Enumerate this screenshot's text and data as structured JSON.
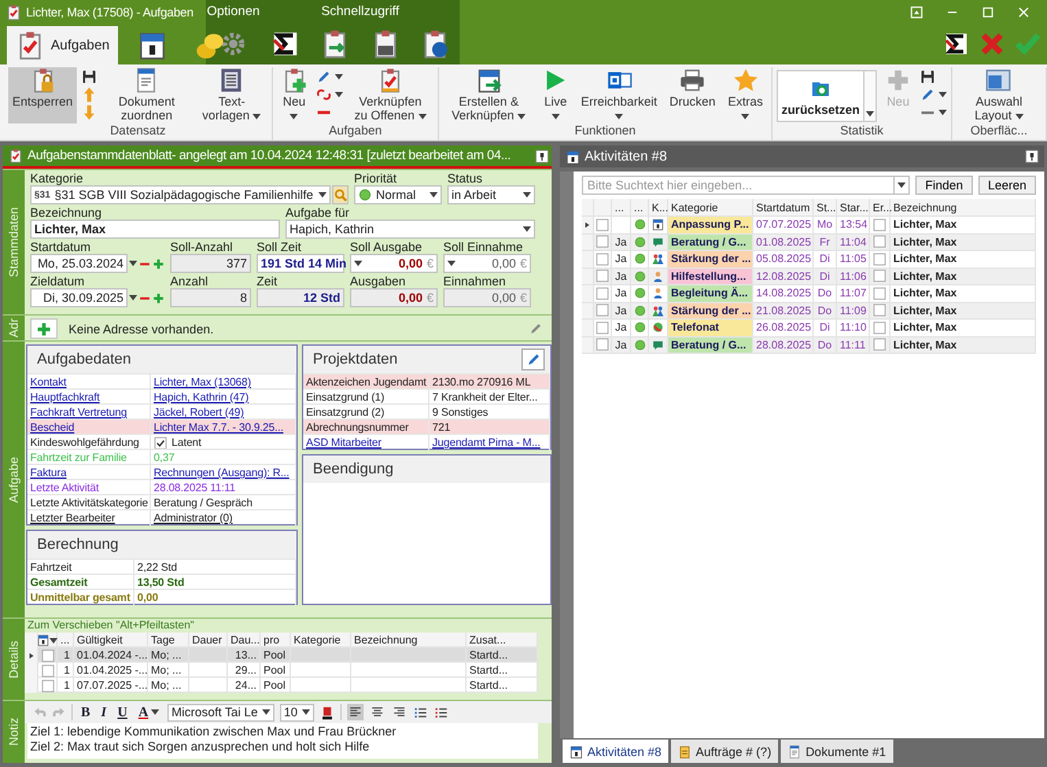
{
  "window": {
    "title": "Lichter, Max (17508) - Aufgaben"
  },
  "context_tabs": [
    {
      "label": "Optionen"
    },
    {
      "label": "Schnellzugriff"
    }
  ],
  "ribbon_tabs": [
    {
      "label": "Aufgaben",
      "selected": true
    },
    {
      "selected": false
    },
    {
      "selected": false
    }
  ],
  "ribbon_groups": [
    {
      "label": "Datensatz",
      "items": [
        {
          "kind": "large",
          "label": "Entsperren",
          "selected": true,
          "dropdown": false,
          "disabled": false
        },
        {
          "kind": "stack",
          "items": [
            {
              "dropdown": false
            },
            {
              "dropdown": false
            },
            {
              "dropdown": false
            }
          ]
        },
        {
          "kind": "large",
          "label": "Dokument zuordnen",
          "selected": false,
          "dropdown": false,
          "disabled": false
        },
        {
          "kind": "large",
          "label": "Text-vorlagen",
          "selected": false,
          "dropdown": true,
          "disabled": false
        }
      ]
    },
    {
      "label": "Aufgaben",
      "items": [
        {
          "kind": "large",
          "label": "Neu",
          "selected": false,
          "dropdown": true,
          "disabled": false
        },
        {
          "kind": "stack",
          "items": [
            {
              "dropdown": true
            },
            {
              "dropdown": true
            },
            {
              "dropdown": false
            }
          ]
        },
        {
          "kind": "large",
          "label": "Verknüpfen zu Offenen",
          "selected": false,
          "dropdown": true,
          "disabled": false
        }
      ]
    },
    {
      "label": "Funktionen",
      "items": [
        {
          "kind": "large",
          "label": "Erstellen & Verknüpfen",
          "selected": false,
          "dropdown": true,
          "disabled": false
        },
        {
          "kind": "large",
          "label": "Live",
          "selected": false,
          "dropdown": true,
          "disabled": false
        },
        {
          "kind": "large",
          "label": "Erreichbarkeit",
          "selected": false,
          "dropdown": true,
          "disabled": false
        },
        {
          "kind": "large",
          "label": "Drucken",
          "selected": false,
          "dropdown": false,
          "disabled": false
        },
        {
          "kind": "large",
          "label": "Extras",
          "selected": false,
          "dropdown": true,
          "disabled": false
        }
      ]
    },
    {
      "label": "Statistik",
      "items": [
        {
          "kind": "gallery",
          "label": "zurücksetzen"
        },
        {
          "kind": "large",
          "label": "Neu",
          "selected": false,
          "dropdown": false,
          "disabled": true
        },
        {
          "kind": "stack",
          "items": [
            {
              "dropdown": false
            },
            {
              "dropdown": true
            },
            {
              "dropdown": true
            }
          ]
        }
      ]
    },
    {
      "label": "Oberfläc...",
      "items": [
        {
          "kind": "large",
          "label": "Auswahl Layout",
          "selected": false,
          "dropdown": true,
          "disabled": false
        }
      ]
    }
  ],
  "task_sheet": {
    "title": "Aufgabenstammdatenblatt- angelegt am 10.04.2024 12:48:31 [zuletzt bearbeitet am 04...",
    "side_tabs": [
      "Stammdaten",
      "Adr",
      "Aufgabe",
      "Details",
      "Notiz"
    ]
  },
  "master_data": {
    "category": {
      "label": "Kategorie",
      "badge": "§31",
      "value": "§31 SGB VIII Sozialpädagogische Familienhilfe"
    },
    "priority": {
      "label": "Priorität",
      "value": "Normal"
    },
    "status": {
      "label": "Status",
      "value": "in Arbeit"
    },
    "title": {
      "label": "Bezeichnung",
      "value": "Lichter, Max"
    },
    "assignee": {
      "label": "Aufgabe für",
      "value": "Hapich, Kathrin"
    },
    "start_date": {
      "label": "Startdatum",
      "value": "Mo, 25.03.2024"
    },
    "target_count": {
      "label": "Soll-Anzahl",
      "value": "377",
      "readonly": true
    },
    "target_time": {
      "label": "Soll Zeit",
      "value": "191 Std 14 Min",
      "readonly": false
    },
    "target_expense": {
      "label": "Soll Ausgabe",
      "value": "0,00",
      "currency": "€",
      "kind": "expense",
      "dropdown": true,
      "readonly": false
    },
    "target_income": {
      "label": "Soll Einnahme",
      "value": "0,00",
      "currency": "€",
      "kind": "income",
      "dropdown": true,
      "readonly": false
    },
    "end_date": {
      "label": "Zieldatum",
      "value": "Di, 30.09.2025"
    },
    "count": {
      "label": "Anzahl",
      "value": "8",
      "readonly": true
    },
    "time": {
      "label": "Zeit",
      "value": "12 Std",
      "readonly": true
    },
    "expenses": {
      "label": "Ausgaben",
      "value": "0,00",
      "currency": "€",
      "kind": "expense",
      "dropdown": false,
      "readonly": true
    },
    "income": {
      "label": "Einnahmen",
      "value": "0,00",
      "currency": "€",
      "kind": "income",
      "dropdown": false,
      "readonly": true
    }
  },
  "address": {
    "text": "Keine Adresse vorhanden."
  },
  "task_data": {
    "title": "Aufgabedaten",
    "rows": [
      {
        "label": "Kontakt",
        "value": "Lichter, Max (13068)",
        "kind": "link",
        "highlighted": false
      },
      {
        "label": "Hauptfachkraft",
        "value": "Hapich, Kathrin (47)",
        "kind": "link",
        "highlighted": false
      },
      {
        "label": "Fachkraft Vertretung",
        "value": "Jäckel, Robert (49)",
        "kind": "link",
        "highlighted": false
      },
      {
        "label": "Bescheid",
        "value": "Lichter Max 7.7. - 30.9.25...",
        "kind": "link",
        "highlighted": true
      },
      {
        "label": "Kindeswohlgefährdung",
        "value": "Latent",
        "kind": "check",
        "checked": true,
        "highlighted": false
      },
      {
        "label": "Fahrtzeit zur Familie",
        "value": "0,37",
        "kind": "travel",
        "highlighted": false
      },
      {
        "label": "Faktura",
        "value": "Rechnungen (Ausgang): R...",
        "kind": "link",
        "highlighted": false
      },
      {
        "label": "Letzte Aktivität",
        "value": "28.08.2025 11:11",
        "kind": "recent",
        "highlighted": false
      },
      {
        "label": "Letzte Aktivitätskategorie",
        "value": "Beratung / Gespräch",
        "kind": "plain",
        "highlighted": false
      },
      {
        "label": "Letzter Bearbeiter",
        "value": "Administrator (0)",
        "kind": "user",
        "highlighted": false
      }
    ]
  },
  "calculation": {
    "title": "Berechnung",
    "rows": [
      {
        "label": "Fahrtzeit",
        "value": "2,22 Std",
        "kind": "plain"
      },
      {
        "label": "Gesamtzeit",
        "value": "13,50 Std",
        "kind": "total"
      },
      {
        "label": "Unmittelbar gesamt",
        "value": "0,00",
        "kind": "direct"
      }
    ]
  },
  "project_data": {
    "title": "Projektdaten",
    "rows": [
      {
        "label": "Aktenzeichen Jugendamt",
        "value": "2130.mo 270916 ML",
        "kind": "plain",
        "highlighted": true
      },
      {
        "label": "Einsatzgrund (1)",
        "value": "7 Krankheit der Elter...",
        "kind": "plain",
        "highlighted": false
      },
      {
        "label": "Einsatzgrund (2)",
        "value": "9 Sonstiges",
        "kind": "plain",
        "highlighted": false
      },
      {
        "label": "Abrechnungsnummer",
        "value": "721",
        "kind": "plain",
        "highlighted": true
      },
      {
        "label": "ASD Mitarbeiter",
        "value": "Jugendamt Pirna - M...",
        "kind": "link",
        "highlighted": false
      }
    ]
  },
  "termination": {
    "title": "Beendigung"
  },
  "details": {
    "hint": "Zum Verschieben \"Alt+Pfeiltasten\"",
    "columns": [
      "...",
      "Gültigkeit",
      "Tage",
      "Dauer",
      "Dau...",
      "pro",
      "Kategorie",
      "Bezeichnung",
      "Zusat..."
    ],
    "rows": [
      {
        "selected": true,
        "checked": false,
        "cells": [
          "1",
          "01.04.2024 -...",
          "Mo; ...",
          null,
          "13...",
          "Pool",
          null,
          null,
          "Startd..."
        ]
      },
      {
        "selected": false,
        "checked": false,
        "cells": [
          "1",
          "01.04.2025 -...",
          "Mo; ...",
          null,
          "29...",
          "Pool",
          null,
          null,
          "Startd..."
        ]
      },
      {
        "selected": false,
        "checked": false,
        "cells": [
          "1",
          "07.07.2025 -...",
          "Mo; ...",
          null,
          "24...",
          "Pool",
          null,
          null,
          "Startd..."
        ]
      }
    ]
  },
  "note": {
    "history": [
      {
        "disabled": true
      },
      {
        "disabled": true
      }
    ],
    "format_buttons": [
      {
        "label": "B"
      },
      {
        "label": "I"
      },
      {
        "label": "U"
      },
      {
        "label": "A",
        "dropdown": true
      }
    ],
    "font": "Microsoft Tai Le",
    "size": "10",
    "alignment": [
      {
        "selected": true
      },
      {
        "selected": false
      },
      {
        "selected": false
      }
    ],
    "lines": [
      "Ziel 1: lebendige Kommunikation zwischen Max und Frau Brückner",
      "Ziel 2: Max traut sich Sorgen anzusprechen und holt sich Hilfe"
    ]
  },
  "activities": {
    "title": "Aktivitäten #8",
    "search": {
      "placeholder": "Bitte Suchtext hier eingeben..."
    },
    "buttons": [
      "Finden",
      "Leeren"
    ],
    "columns": [
      "...",
      "...",
      "K...",
      "Kategorie",
      "Startdatum",
      "St...",
      "Star...",
      "Er...",
      "Bezeichnung"
    ],
    "rows": [
      {
        "selected": true,
        "checked": false,
        "kind": "appointment",
        "category": "Anpassung P...",
        "color": "#f9e79a",
        "date": "07.07.2025",
        "day": "Mo",
        "time": "13:54",
        "done": false,
        "name": "Lichter, Max"
      },
      {
        "selected": false,
        "checked": false,
        "flag": "Ja",
        "kind": "consultation",
        "category": "Beratung / G...",
        "color": "#bfe5ad",
        "date": "01.08.2025",
        "day": "Fr",
        "time": "11:04",
        "done": false,
        "name": "Lichter, Max"
      },
      {
        "selected": false,
        "checked": false,
        "flag": "Ja",
        "kind": "group",
        "category": "Stärkung der ...",
        "color": "#fbd3ad",
        "date": "05.08.2025",
        "day": "Di",
        "time": "11:05",
        "done": false,
        "name": "Lichter, Max"
      },
      {
        "selected": false,
        "checked": false,
        "flag": "Ja",
        "kind": "person",
        "category": "Hilfestellung...",
        "color": "#f8c3d4",
        "date": "12.08.2025",
        "day": "Di",
        "time": "11:06",
        "done": false,
        "name": "Lichter, Max"
      },
      {
        "selected": false,
        "checked": false,
        "flag": "Ja",
        "kind": "person",
        "category": "Begleitung Ä...",
        "color": "#bfe5ad",
        "date": "14.08.2025",
        "day": "Do",
        "time": "11:07",
        "done": false,
        "name": "Lichter, Max"
      },
      {
        "selected": false,
        "checked": false,
        "flag": "Ja",
        "kind": "group",
        "category": "Stärkung der ...",
        "color": "#fbd3ad",
        "date": "21.08.2025",
        "day": "Do",
        "time": "11:09",
        "done": false,
        "name": "Lichter, Max"
      },
      {
        "selected": false,
        "checked": false,
        "flag": "Ja",
        "kind": "call",
        "category": "Telefonat",
        "color": "#f9e79a",
        "date": "26.08.2025",
        "day": "Di",
        "time": "11:10",
        "done": false,
        "name": "Lichter, Max"
      },
      {
        "selected": false,
        "checked": false,
        "flag": "Ja",
        "kind": "consultation",
        "category": "Beratung / G...",
        "color": "#bfe5ad",
        "date": "28.08.2025",
        "day": "Do",
        "time": "11:11",
        "done": false,
        "name": "Lichter, Max"
      }
    ]
  },
  "bottom_tabs": [
    {
      "label": "Aktivitäten #8",
      "selected": true
    },
    {
      "label": "Aufträge # (?)",
      "selected": false
    },
    {
      "label": "Dokumente #1",
      "selected": false
    }
  ]
}
